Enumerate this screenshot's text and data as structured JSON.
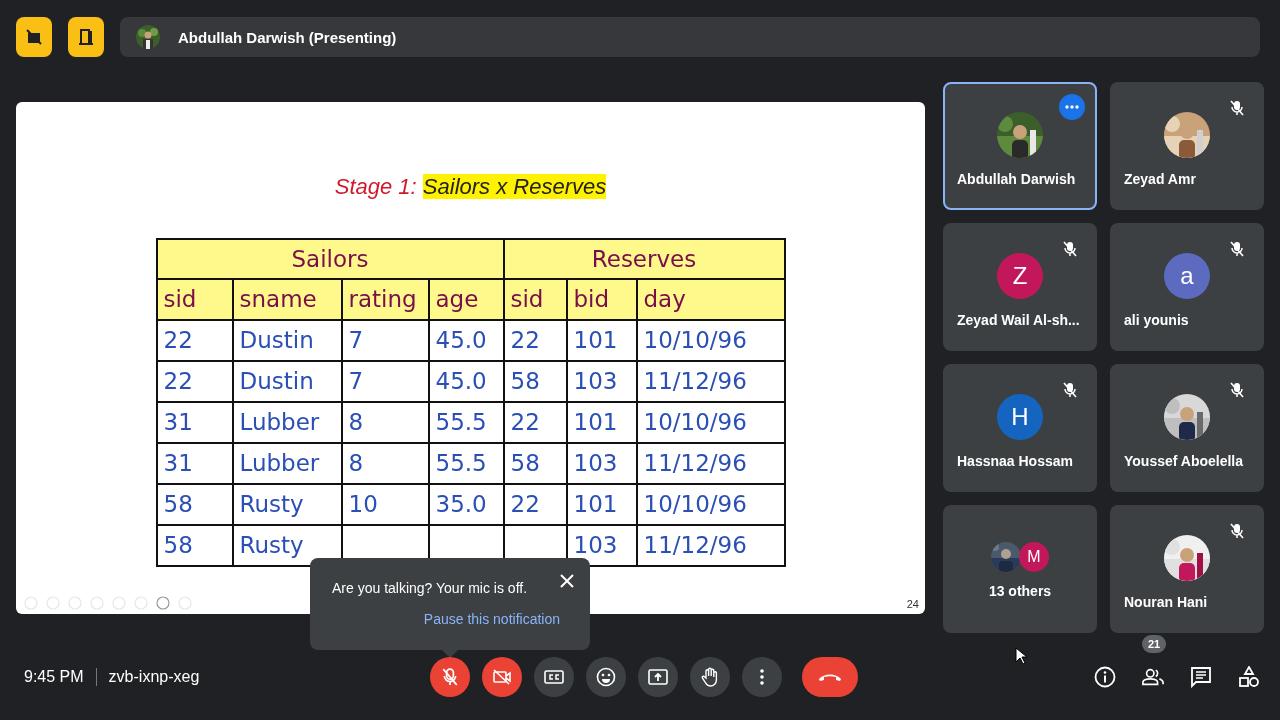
{
  "top_bar": {
    "presenter": "Abdullah Darwish (Presenting)"
  },
  "slide": {
    "title": {
      "prefix": "Stage 1:",
      "highlight": "Sailors x Reserves"
    },
    "page_number": "24",
    "table": {
      "groups": [
        {
          "label": "Sailors",
          "columns": [
            "sid",
            "sname",
            "rating",
            "age"
          ]
        },
        {
          "label": "Reserves",
          "columns": [
            "sid",
            "bid",
            "day"
          ]
        }
      ],
      "rows": [
        [
          "22",
          "Dustin",
          "7",
          "45.0",
          "22",
          "101",
          "10/10/96"
        ],
        [
          "22",
          "Dustin",
          "7",
          "45.0",
          "58",
          "103",
          "11/12/96"
        ],
        [
          "31",
          "Lubber",
          "8",
          "55.5",
          "22",
          "101",
          "10/10/96"
        ],
        [
          "31",
          "Lubber",
          "8",
          "55.5",
          "58",
          "103",
          "11/12/96"
        ],
        [
          "58",
          "Rusty",
          "10",
          "35.0",
          "22",
          "101",
          "10/10/96"
        ],
        [
          "58",
          "Rusty",
          null,
          null,
          null,
          "103",
          "11/12/96"
        ]
      ]
    }
  },
  "participants": [
    {
      "name": "Abdullah Darwish",
      "selected": true,
      "muted": false
    },
    {
      "name": "Zeyad Amr",
      "selected": false,
      "muted": true
    },
    {
      "name": "Zeyad Wail Al-sh...",
      "kind": "letter",
      "letter": "Z",
      "color": "#c2185b",
      "selected": false,
      "muted": true
    },
    {
      "name": "ali younis",
      "kind": "letter",
      "letter": "a",
      "color": "#5c6bc0",
      "selected": false,
      "muted": true
    },
    {
      "name": "Hassnaa Hossam",
      "kind": "letter",
      "letter": "H",
      "color": "#1565c0",
      "selected": false,
      "muted": true
    },
    {
      "name": "Youssef Aboelella",
      "selected": false,
      "muted": true
    },
    {
      "name": "13 others",
      "kind": "group",
      "letter": "M",
      "color": "#c2185b",
      "selected": false,
      "muted": false
    },
    {
      "name": "Nouran Hani",
      "selected": false,
      "muted": true
    }
  ],
  "notification": {
    "message": "Are you talking? Your mic is off.",
    "action": "Pause this notification"
  },
  "bottom_bar": {
    "time": "9:45 PM",
    "meeting_code": "zvb-ixnp-xeg",
    "controls": [
      {
        "kind": "mic",
        "on": false
      },
      {
        "kind": "camera",
        "on": false
      },
      {
        "kind": "captions"
      },
      {
        "kind": "emoji"
      },
      {
        "kind": "present"
      },
      {
        "kind": "hand"
      },
      {
        "kind": "more"
      },
      {
        "kind": "leave"
      }
    ],
    "people_count": "21"
  }
}
